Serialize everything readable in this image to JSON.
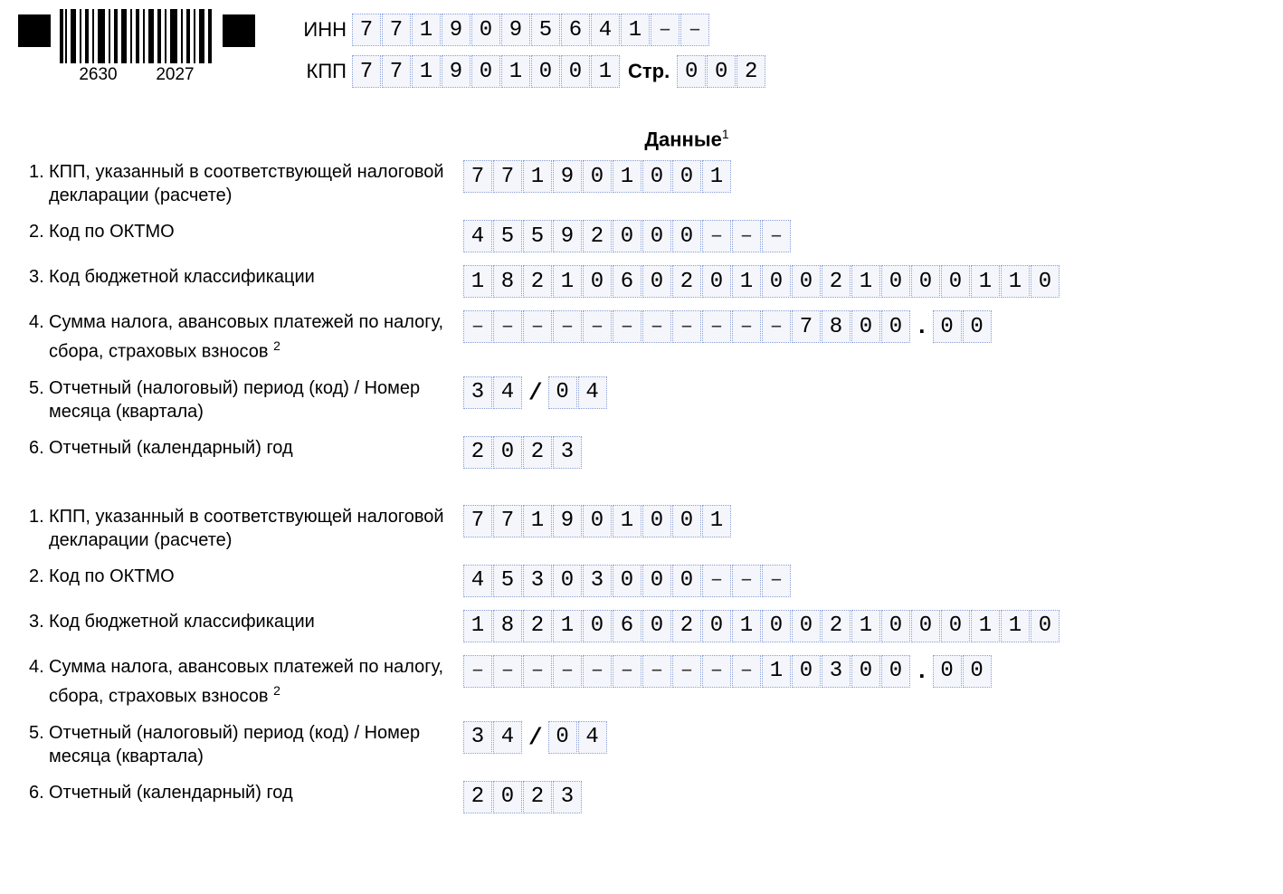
{
  "barcode": {
    "left_num": "2630",
    "right_num": "2027"
  },
  "header": {
    "inn_label": "ИНН",
    "inn": [
      "7",
      "7",
      "1",
      "9",
      "0",
      "9",
      "5",
      "6",
      "4",
      "1",
      "–",
      "–"
    ],
    "kpp_label": "КПП",
    "kpp": [
      "7",
      "7",
      "1",
      "9",
      "0",
      "1",
      "0",
      "0",
      "1"
    ],
    "page_label": "Стр.",
    "page": [
      "0",
      "0",
      "2"
    ]
  },
  "section_title": "Данные",
  "section_sup": "1",
  "labels": {
    "l1": "КПП, указанный в соответствующей налоговой декларации (расчете)",
    "l2": "Код по ОКТМО",
    "l3": "Код бюджетной классификации",
    "l4_a": "Сумма налога, авансовых платежей по налогу, сбора, страховых взносов",
    "l4_sup": "2",
    "l5": "Отчетный (налоговый) период (код) / Номер месяца (квартала)",
    "l6": "Отчетный (календарный) год"
  },
  "blocks": [
    {
      "kpp": [
        "7",
        "7",
        "1",
        "9",
        "0",
        "1",
        "0",
        "0",
        "1"
      ],
      "oktmo": [
        "4",
        "5",
        "5",
        "9",
        "2",
        "0",
        "0",
        "0",
        "–",
        "–",
        "–"
      ],
      "kbk": [
        "1",
        "8",
        "2",
        "1",
        "0",
        "6",
        "0",
        "2",
        "0",
        "1",
        "0",
        "0",
        "2",
        "1",
        "0",
        "0",
        "0",
        "1",
        "1",
        "0"
      ],
      "sum_int": [
        "–",
        "–",
        "–",
        "–",
        "–",
        "–",
        "–",
        "–",
        "–",
        "–",
        "–",
        "7",
        "8",
        "0",
        "0"
      ],
      "sum_frac": [
        "0",
        "0"
      ],
      "period_code": [
        "3",
        "4"
      ],
      "period_num": [
        "0",
        "4"
      ],
      "year": [
        "2",
        "0",
        "2",
        "3"
      ]
    },
    {
      "kpp": [
        "7",
        "7",
        "1",
        "9",
        "0",
        "1",
        "0",
        "0",
        "1"
      ],
      "oktmo": [
        "4",
        "5",
        "3",
        "0",
        "3",
        "0",
        "0",
        "0",
        "–",
        "–",
        "–"
      ],
      "kbk": [
        "1",
        "8",
        "2",
        "1",
        "0",
        "6",
        "0",
        "2",
        "0",
        "1",
        "0",
        "0",
        "2",
        "1",
        "0",
        "0",
        "0",
        "1",
        "1",
        "0"
      ],
      "sum_int": [
        "–",
        "–",
        "–",
        "–",
        "–",
        "–",
        "–",
        "–",
        "–",
        "–",
        "1",
        "0",
        "3",
        "0",
        "0"
      ],
      "sum_frac": [
        "0",
        "0"
      ],
      "period_code": [
        "3",
        "4"
      ],
      "period_num": [
        "0",
        "4"
      ],
      "year": [
        "2",
        "0",
        "2",
        "3"
      ]
    }
  ]
}
